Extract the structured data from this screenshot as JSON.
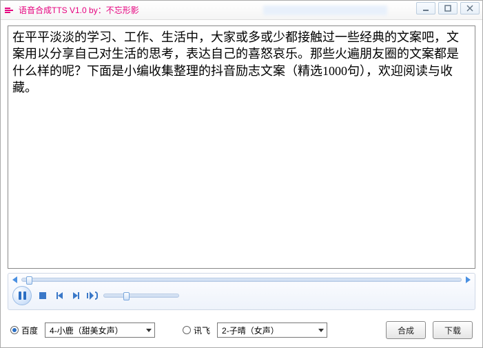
{
  "window": {
    "title": "语音合成TTS V1.0 by：不忘形影"
  },
  "textarea": {
    "value": "在平平淡淡的学习、工作、生活中，大家或多或少都接触过一些经典的文案吧，文案用以分享自己对生活的思考，表达自己的喜怒哀乐。那些火遍朋友圈的文案都是什么样的呢？下面是小编收集整理的抖音励志文案（精选1000句），欢迎阅读与收藏。"
  },
  "engines": {
    "baidu": {
      "label": "百度",
      "selected": true
    },
    "xunfei": {
      "label": "讯飞",
      "selected": false
    }
  },
  "voices": {
    "baidu_selected": "4-小鹿（甜美女声）",
    "xunfei_selected": "2-子晴（女声）"
  },
  "buttons": {
    "synthesize": "合成",
    "download": "下载"
  }
}
